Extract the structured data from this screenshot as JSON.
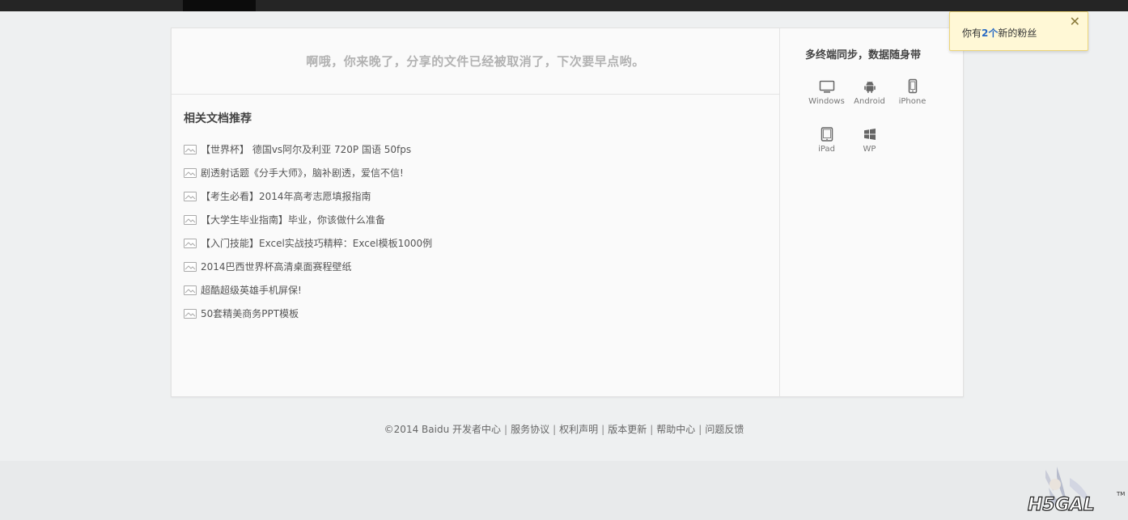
{
  "notice": {
    "text": "啊哦，你来晚了，分享的文件已经被取消了，下次要早点哟。"
  },
  "related": {
    "title": "相关文档推荐",
    "items": [
      "【世界杯】 德国vs阿尔及利亚 720P 国语 50fps",
      "剧透射话题《分手大师》，脑补剧透，爱信不信!",
      "【考生必看】2014年高考志愿填报指南",
      "【大学生毕业指南】毕业，你该做什么准备",
      "【入门技能】Excel实战技巧精粹：Excel模板1000例",
      "2014巴西世界杯高清桌面赛程壁纸",
      "超酷超级英雄手机屏保!",
      "50套精美商务PPT模板"
    ]
  },
  "sidebar": {
    "title": "多终端同步，数据随身带",
    "platforms": [
      {
        "label": "Windows",
        "icon": "monitor-icon"
      },
      {
        "label": "Android",
        "icon": "android-icon"
      },
      {
        "label": "iPhone",
        "icon": "phone-icon"
      },
      {
        "label": "iPad",
        "icon": "tablet-icon"
      },
      {
        "label": "WP",
        "icon": "windows-logo-icon"
      }
    ]
  },
  "footer": {
    "copyright": "©2014 Baidu",
    "links": [
      "开发者中心",
      "服务协议",
      "权利声明",
      "版本更新",
      "帮助中心",
      "问题反馈"
    ]
  },
  "toast": {
    "prefix": "你有",
    "count": "2个",
    "suffix": "新的粉丝",
    "close": "✕"
  },
  "watermark": {
    "text": "H5GAL",
    "mark": "TM"
  },
  "colors": {
    "topbar": "#252525",
    "toast_bg": "#fff8d6",
    "toast_border": "#ecd57a",
    "link_accent": "#2a6bc4"
  }
}
